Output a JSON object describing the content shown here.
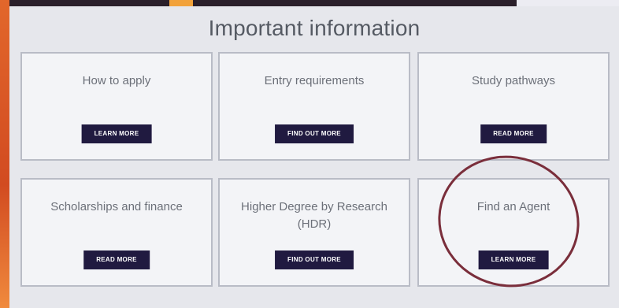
{
  "page": {
    "title": "Important information"
  },
  "cards": [
    {
      "title": "How to apply",
      "button": "LEARN MORE"
    },
    {
      "title": "Entry requirements",
      "button": "FIND OUT MORE"
    },
    {
      "title": "Study pathways",
      "button": "READ MORE"
    },
    {
      "title": "Scholarships and finance",
      "button": "READ MORE"
    },
    {
      "title": "Higher Degree by Research (HDR)",
      "button": "FIND OUT MORE"
    },
    {
      "title": "Find an Agent",
      "button": "LEARN MORE"
    }
  ],
  "colors": {
    "button_bg": "#201a40",
    "highlight": "#7a2e3b",
    "background_orange": "#d9532a"
  }
}
